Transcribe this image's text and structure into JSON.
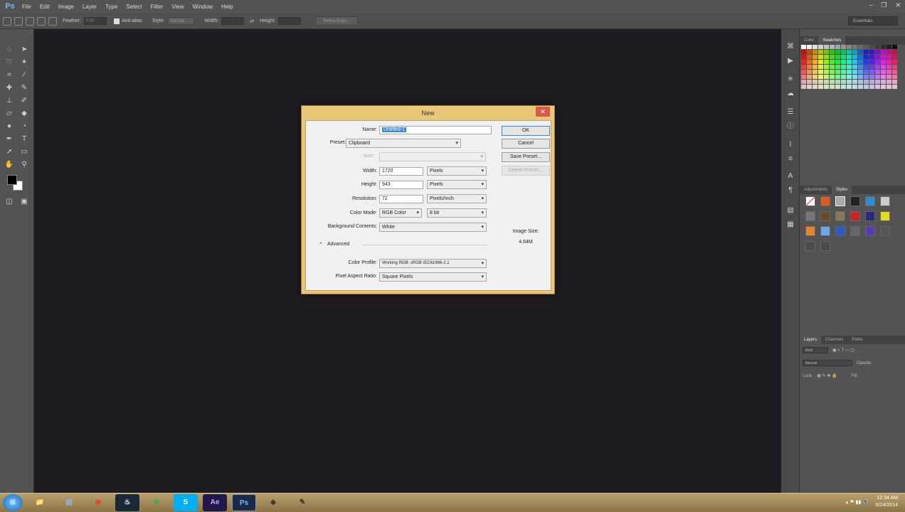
{
  "app": {
    "logo": "Ps",
    "menu": [
      "File",
      "Edit",
      "Image",
      "Layer",
      "Type",
      "Select",
      "Filter",
      "View",
      "Window",
      "Help"
    ],
    "window_controls": [
      "–",
      "❐",
      "✕"
    ]
  },
  "options_bar": {
    "feather_label": "Feather:",
    "feather_value": "0 px",
    "antialias_label": "Anti-alias",
    "style_label": "Style:",
    "style_value": "Normal",
    "width_label": "Width:",
    "height_label": "Height:",
    "refine_label": "Refine Edge...",
    "workspace": "Essentials"
  },
  "panels": {
    "color_tabs": [
      "Color",
      "Swatches"
    ],
    "adjust_tabs": [
      "Adjustments",
      "Styles"
    ],
    "layers_tabs": [
      "Layers",
      "Channels",
      "Paths"
    ],
    "layers_kind": "Kind",
    "layers_blend": "Normal",
    "opacity_label": "Opacity:",
    "lock_label": "Lock:",
    "fill_label": "Fill:"
  },
  "dialog": {
    "title": "New",
    "name_label": "Name:",
    "name_value": "Untitled-1",
    "preset_label": "Preset:",
    "preset_value": "Clipboard",
    "size_label": "Size:",
    "width_label": "Width:",
    "width_value": "1720",
    "width_unit": "Pixels",
    "height_label": "Height:",
    "height_value": "943",
    "height_unit": "Pixels",
    "resolution_label": "Resolution:",
    "resolution_value": "72",
    "resolution_unit": "Pixels/Inch",
    "color_mode_label": "Color Mode:",
    "color_mode_value": "RGB Color",
    "bit_depth": "8 bit",
    "background_label": "Background Contents:",
    "background_value": "White",
    "advanced_label": "Advanced",
    "color_profile_label": "Color Profile:",
    "color_profile_value": "Working RGB: sRGB IEC61966-2.1",
    "aspect_label": "Pixel Aspect Ratio:",
    "aspect_value": "Square Pixels",
    "ok_label": "OK",
    "cancel_label": "Cancel",
    "save_preset_label": "Save Preset...",
    "delete_preset_label": "Delete Preset...",
    "image_size_label": "Image Size:",
    "image_size_value": "4.64M"
  },
  "taskbar": {
    "apps": [
      "📁",
      "▤",
      "◉",
      "♨",
      "≋",
      "S",
      "Ae",
      "Ps",
      "◈",
      "✎"
    ],
    "time": "12:34 AM",
    "date": "6/24/2014"
  },
  "colors": {
    "accent_selection": "#3d86dc",
    "dialog_frame": "#e8c878",
    "ui_gray": "#535353",
    "canvas": "#1e1c22"
  }
}
